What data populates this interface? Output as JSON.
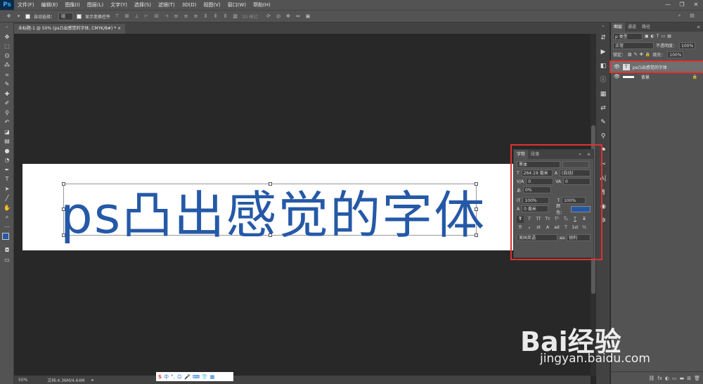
{
  "app": {
    "logo": "Ps"
  },
  "menu": [
    "文件(F)",
    "编辑(E)",
    "图像(I)",
    "图层(L)",
    "文字(Y)",
    "选择(S)",
    "滤镜(T)",
    "3D(D)",
    "视图(V)",
    "窗口(W)",
    "帮助(H)"
  ],
  "window_controls": [
    "—",
    "❐",
    "✕"
  ],
  "options": {
    "auto_select_label": "自动选择：",
    "auto_select_value": "组",
    "show_transform_label": "显示变换控件",
    "mode_3d": "3D 模式："
  },
  "document_tab": "未标题-1 @ 50% (ps凸出感觉的字体, CMYK/8#) *",
  "canvas_text": "ps凸出感觉的字体",
  "layers_panel": {
    "tabs": [
      "图层",
      "通道",
      "路径"
    ],
    "kind_label": "p 类型",
    "blend_mode": "正常",
    "opacity_label": "不透明度：",
    "opacity_value": "100%",
    "lock_label": "锁定：",
    "fill_label": "填充：",
    "fill_value": "100%",
    "layers": [
      {
        "name": "ps凸出感觉的字体",
        "thumb": "T"
      },
      {
        "name": "背景"
      }
    ],
    "footer_icons": [
      "fx",
      "◐",
      "▭",
      "▬",
      "⊞",
      "🗑"
    ]
  },
  "character_panel": {
    "tabs": [
      "字符",
      "段落"
    ],
    "font_family": "黑体",
    "font_size": "264.19 毫米",
    "leading": "(自动)",
    "kerning": "0",
    "tracking": "0",
    "tsume": "0%",
    "vertical_scale": "100%",
    "horizontal_scale": "100%",
    "baseline_shift": "0 毫米",
    "color_label": "颜色：",
    "language": "美国英语",
    "anti_alias": "锐利",
    "aa_icon": "aa"
  },
  "status": {
    "zoom": "50%",
    "doc_size": "文档:4.36M/4.64M"
  },
  "watermark": {
    "brand": "Bai经验",
    "url": "jingyan.baidu.com"
  },
  "colors": {
    "text_blue": "#2559a7",
    "highlight_red": "#dd3333"
  }
}
